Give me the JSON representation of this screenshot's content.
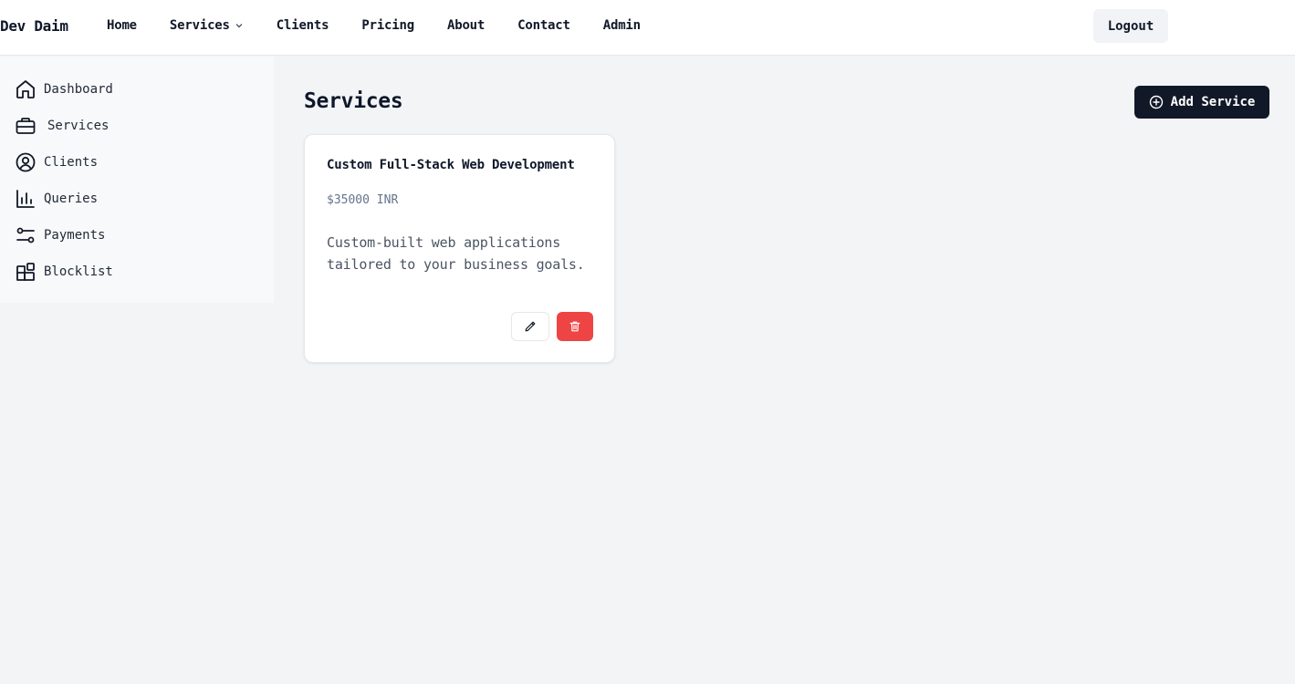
{
  "brand": "Dev Daim",
  "nav": {
    "items": [
      {
        "label": "Home"
      },
      {
        "label": "Services",
        "dropdown_icon": "chevron-down-icon"
      },
      {
        "label": "Clients"
      },
      {
        "label": "Pricing"
      },
      {
        "label": "About"
      },
      {
        "label": "Contact"
      },
      {
        "label": "Admin"
      }
    ],
    "logout_label": "Logout"
  },
  "sidebar": {
    "items": [
      {
        "label": "Dashboard",
        "icon": "home-icon"
      },
      {
        "label": "Services",
        "icon": "briefcase-icon"
      },
      {
        "label": "Clients",
        "icon": "user-circle-icon"
      },
      {
        "label": "Queries",
        "icon": "bar-chart-icon"
      },
      {
        "label": "Payments",
        "icon": "sliders-icon"
      },
      {
        "label": "Blocklist",
        "icon": "blocks-icon"
      }
    ]
  },
  "main": {
    "title": "Services",
    "add_button_label": "Add Service",
    "add_button_icon": "plus-circle-icon"
  },
  "services": [
    {
      "title": "Custom Full-Stack Web Development",
      "price": "$35000 INR",
      "description": "Custom-built web applications tailored to your business goals.",
      "edit_icon": "pencil-icon",
      "delete_icon": "trash-icon"
    }
  ],
  "colors": {
    "primary_dark": "#111827",
    "danger": "#ef4444",
    "page_bg": "#f3f4f6",
    "card_bg": "#ffffff"
  }
}
